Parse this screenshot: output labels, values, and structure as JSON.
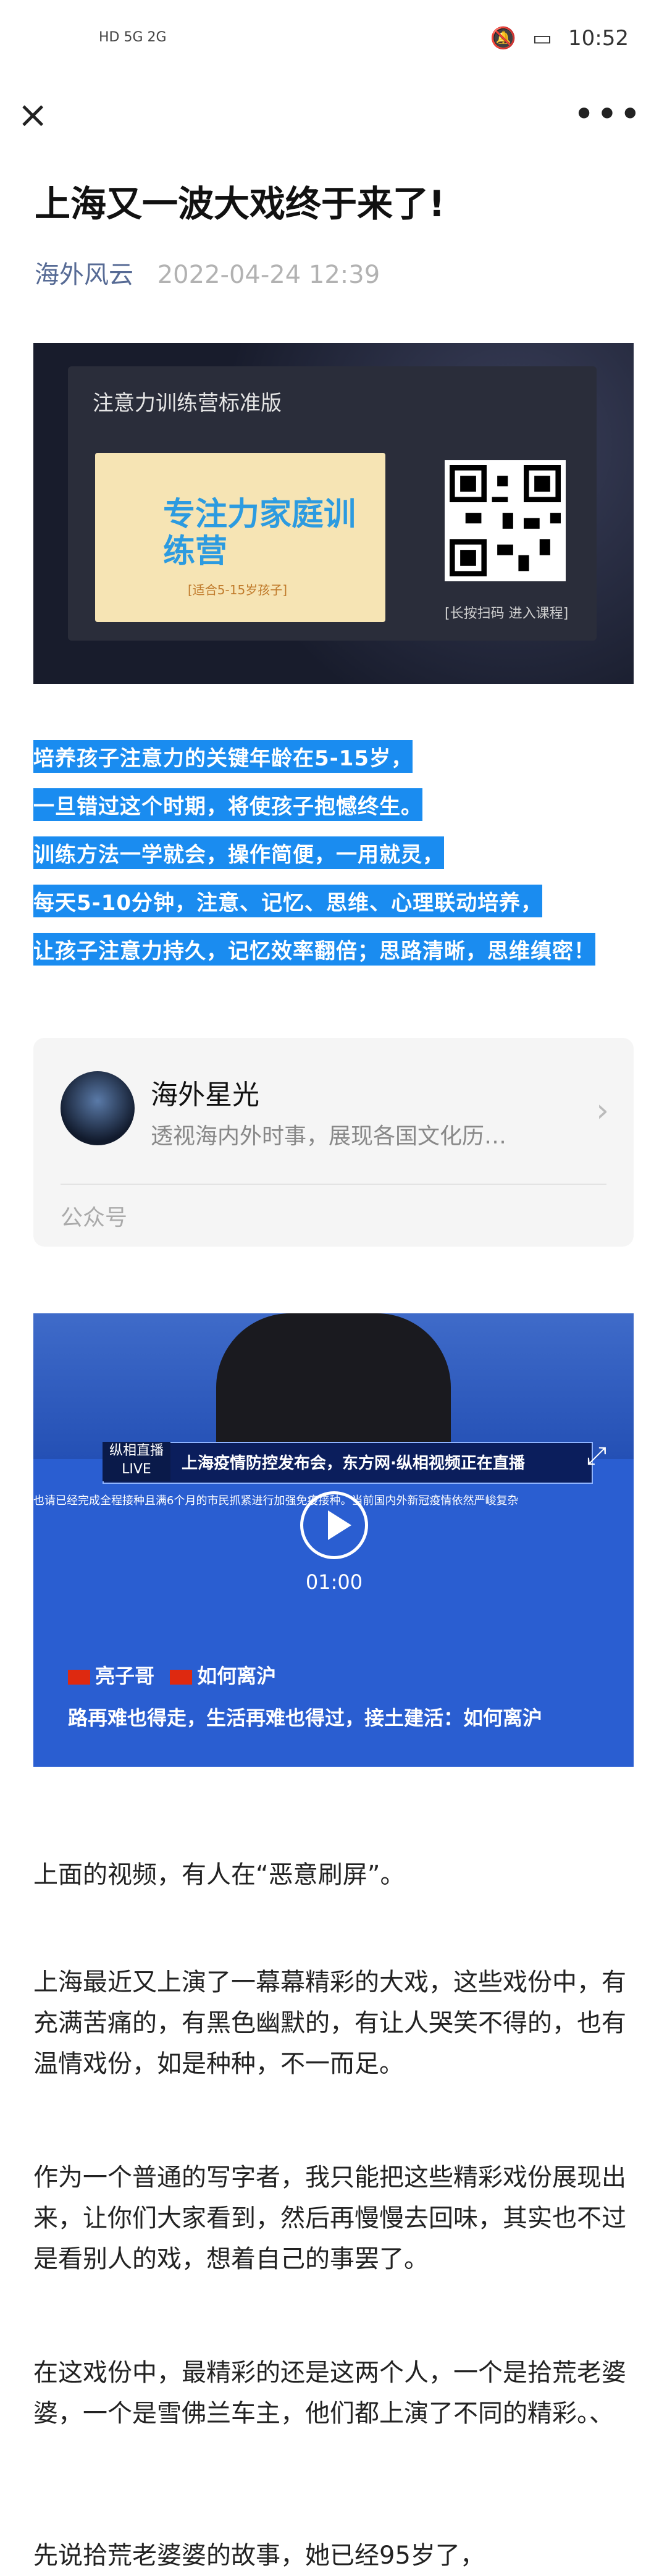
{
  "status_bar": {
    "left_indicators": "HD 5G 2G",
    "time": "10:52"
  },
  "topbar": {
    "close_icon": "×",
    "more_icon": "•••"
  },
  "article": {
    "title": "上海又一波大戏终于来了!",
    "author": "海外风云",
    "date": "2022-04-24 12:39"
  },
  "banner": {
    "inner_title": "注意力训练营标准版",
    "poster_title": "专注力家庭训练营",
    "poster_subtitle": "[适合5-15岁孩子]",
    "qr_caption": "[长按扫码  进入课程]"
  },
  "highlights": [
    "培养孩子注意力的关键年龄在5-15岁，",
    "一旦错过这个时期，将使孩子抱憾终生。",
    "训练方法一学就会，操作简便，一用就灵，",
    "每天5-10分钟，注意、记忆、思维、心理联动培养，",
    "让孩子注意力持久，记忆效率翻倍；思路清晰，思维缜密！"
  ],
  "account_card": {
    "name": "海外星光",
    "description": "透视海内外时事，展现各国文化历…",
    "type": "公众号"
  },
  "video": {
    "logo": "纵相直播LIVE",
    "caption": "上海疫情防控发布会，东方网·纵相视频正在直播",
    "ticker": "也请已经完成全程接种且满6个月的市民抓紧进行加强免疫接种。当前国内外新冠疫情依然严峻复杂",
    "duration": "01:00",
    "subtitle_user": "亮子哥",
    "subtitle_text": "如何离沪",
    "subtitle_line": "路再难也得走，生活再难也得过，接土建活：如何离沪"
  },
  "paragraphs": [
    "上面的视频，有人在“恶意刷屏”。",
    "上海最近又上演了一幕幕精彩的大戏，这些戏份中，有充满苦痛的，有黑色幽默的，有让人哭笑不得的，也有温情戏份，如是种种，不一而足。",
    "作为一个普通的写字者，我只能把这些精彩戏份展现出来，让你们大家看到，然后再慢慢去回味，其实也不过是看别人的戏，想着自己的事罢了。",
    "在这戏份中，最精彩的还是这两个人，一个是拾荒老婆婆，一个是雪佛兰车主，他们都上演了不同的精彩。、",
    "先说拾荒老婆婆的故事，她已经95岁了，"
  ],
  "colors": {
    "author_link": "#576b95",
    "highlight_bg": "#1a8cf0"
  }
}
